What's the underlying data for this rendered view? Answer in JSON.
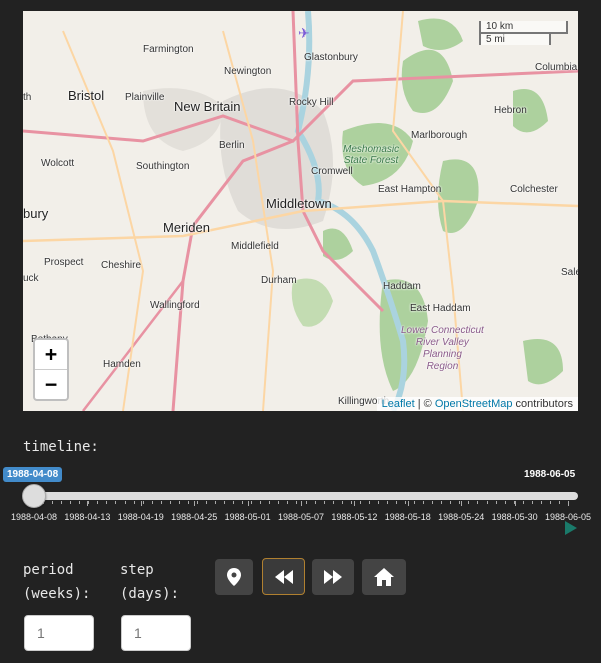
{
  "map": {
    "towns": [
      {
        "name": "Farmington",
        "cls": ""
      },
      {
        "name": "Glastonbury",
        "cls": ""
      },
      {
        "name": "Columbia",
        "cls": ""
      },
      {
        "name": "Bristol",
        "cls": "big"
      },
      {
        "name": "Plainville",
        "cls": ""
      },
      {
        "name": "Newington",
        "cls": ""
      },
      {
        "name": "New Britain",
        "cls": "big"
      },
      {
        "name": "Rocky Hill",
        "cls": ""
      },
      {
        "name": "Hebron",
        "cls": ""
      },
      {
        "name": "Marlborough",
        "cls": ""
      },
      {
        "name": "Wolcott",
        "cls": ""
      },
      {
        "name": "Southington",
        "cls": ""
      },
      {
        "name": "Berlin",
        "cls": ""
      },
      {
        "name": "Cromwell",
        "cls": ""
      },
      {
        "name": "East Hampton",
        "cls": ""
      },
      {
        "name": "Colchester",
        "cls": ""
      },
      {
        "name": "Middletown",
        "cls": "big"
      },
      {
        "name": "Meriden",
        "cls": "big"
      },
      {
        "name": "Middlefield",
        "cls": ""
      },
      {
        "name": "Prospect",
        "cls": ""
      },
      {
        "name": "Cheshire",
        "cls": ""
      },
      {
        "name": "Durham",
        "cls": ""
      },
      {
        "name": "Haddam",
        "cls": ""
      },
      {
        "name": "Wallingford",
        "cls": ""
      },
      {
        "name": "East Haddam",
        "cls": ""
      },
      {
        "name": "Hamden",
        "cls": ""
      },
      {
        "name": "Killingworth",
        "cls": ""
      },
      {
        "name": "bury",
        "cls": "big"
      },
      {
        "name": "th",
        "cls": ""
      },
      {
        "name": "uck",
        "cls": ""
      },
      {
        "name": "Sale",
        "cls": ""
      },
      {
        "name": "Bethany",
        "cls": ""
      }
    ],
    "forest_label": "Meshomasic\nState Forest",
    "region_label": "Lower Connecticut\nRiver Valley\nPlanning\nRegion",
    "zoom_in": "+",
    "zoom_out": "−",
    "scale_km": "10 km",
    "scale_mi": "5 mi",
    "attribution_link": "Leaflet",
    "attribution_sep": " | © ",
    "attribution_osm": "OpenStreetMap",
    "attribution_tail": " contributors",
    "colors": {
      "land": "#f2efe9",
      "forest": "#add19e",
      "water": "#aad3df",
      "highway": "#e892a2",
      "major": "#fcd6a4"
    }
  },
  "timeline": {
    "label": "timeline:",
    "current": "1988-04-08",
    "max": "1988-06-05",
    "progress": 0,
    "ticks": [
      "1988-04-08",
      "1988-04-13",
      "1988-04-19",
      "1988-04-25",
      "1988-05-01",
      "1988-05-07",
      "1988-05-12",
      "1988-05-18",
      "1988-05-24",
      "1988-05-30",
      "1988-06-05"
    ]
  },
  "controls": {
    "period_label_1": "period",
    "period_label_2": "(weeks):",
    "step_label_1": "step",
    "step_label_2": "(days):",
    "period_placeholder": "1",
    "step_placeholder": "1",
    "buttons": [
      "map-marker-icon",
      "rewind-icon",
      "fast-forward-icon",
      "home-icon"
    ]
  }
}
